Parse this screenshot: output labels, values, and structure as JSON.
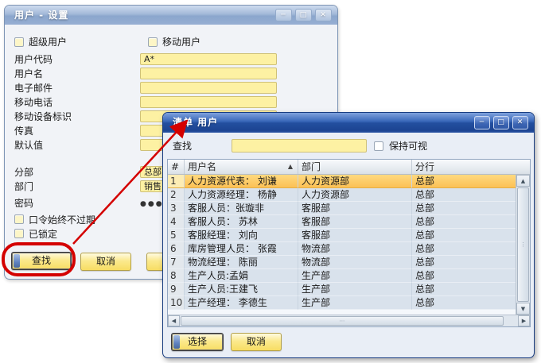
{
  "back_window": {
    "title": "用户 - 设置",
    "window_controls": {
      "minimize": "─",
      "maximize": "□",
      "close": "✕"
    },
    "top_checkboxes": [
      {
        "label": "超级用户"
      },
      {
        "label": "移动用户"
      }
    ],
    "fields": [
      {
        "label": "用户代码",
        "value": "A*"
      },
      {
        "label": "用户名",
        "value": ""
      },
      {
        "label": "电子邮件",
        "value": ""
      },
      {
        "label": "移动电话",
        "value": ""
      },
      {
        "label": "移动设备标识",
        "value": ""
      },
      {
        "label": "传真",
        "value": ""
      },
      {
        "label": "默认值",
        "value": ""
      }
    ],
    "detail_fields": [
      {
        "label": "分部",
        "value": "总部"
      },
      {
        "label": "部门",
        "value": "销售"
      }
    ],
    "password_field": {
      "label": "密码",
      "value": "●●●●●"
    },
    "bottom_checkboxes": [
      {
        "label": "口令始终不过期"
      },
      {
        "label": "已锁定"
      }
    ],
    "find_button": "查找",
    "cancel_button": "取消"
  },
  "front_window": {
    "title": "清单 用户",
    "window_controls": {
      "minimize": "─",
      "maximize": "□",
      "close": "✕"
    },
    "find_label": "查找",
    "find_value": "",
    "keep_visible_label": "保持可视",
    "table": {
      "columns": [
        "#",
        "用户名",
        "部门",
        "分行"
      ],
      "sort_icon": "▲",
      "rows": [
        {
          "num": "1",
          "name": "人力资源代表： 刘谦",
          "dept": "人力资源部",
          "branch": "总部",
          "selected": true
        },
        {
          "num": "2",
          "name": "人力资源经理： 杨静",
          "dept": "人力资源部",
          "branch": "总部",
          "selected": false
        },
        {
          "num": "3",
          "name": "客服人员：张璇非",
          "dept": "客服部",
          "branch": "总部",
          "selected": false
        },
        {
          "num": "4",
          "name": "客服人员： 苏林",
          "dept": "客服部",
          "branch": "总部",
          "selected": false
        },
        {
          "num": "5",
          "name": "客服经理： 刘向",
          "dept": "客服部",
          "branch": "总部",
          "selected": false
        },
        {
          "num": "6",
          "name": "库房管理人员： 张霞",
          "dept": "物流部",
          "branch": "总部",
          "selected": false
        },
        {
          "num": "7",
          "name": "物流经理： 陈丽",
          "dept": "物流部",
          "branch": "总部",
          "selected": false
        },
        {
          "num": "8",
          "name": "生产人员:孟娟",
          "dept": "生产部",
          "branch": "总部",
          "selected": false
        },
        {
          "num": "9",
          "name": "生产人员:王建飞",
          "dept": "生产部",
          "branch": "总部",
          "selected": false
        },
        {
          "num": "10",
          "name": "生产经理： 李德生",
          "dept": "生产部",
          "branch": "总部",
          "selected": false
        }
      ]
    },
    "scroll_icons": {
      "up": "▲",
      "down": "▼",
      "left": "◀",
      "right": "▶",
      "grip_v": "⋮",
      "grip_h": "⋯"
    },
    "select_button": "选择",
    "cancel_button": "取消"
  },
  "annotation": {
    "color": "#d40000"
  }
}
